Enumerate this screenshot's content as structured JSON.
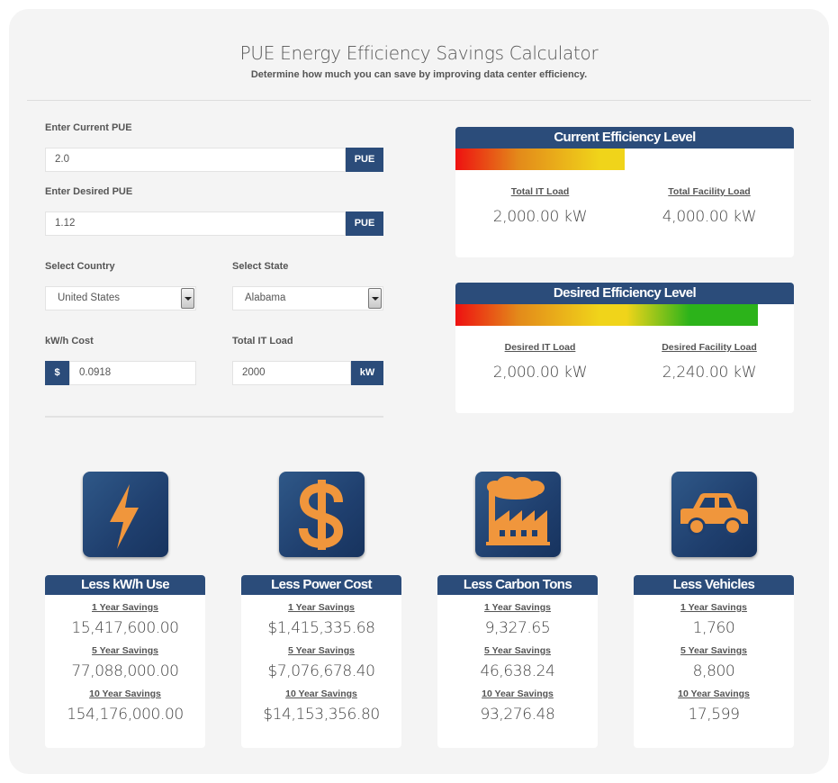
{
  "header": {
    "title": "PUE Energy Efficiency Savings Calculator",
    "subtitle": "Determine how much you can save by improving data center efficiency."
  },
  "form": {
    "current_pue": {
      "label": "Enter Current PUE",
      "value": "2.0",
      "addon": "PUE"
    },
    "desired_pue": {
      "label": "Enter Desired PUE",
      "value": "1.12",
      "addon": "PUE"
    },
    "country": {
      "label": "Select Country",
      "selected": "United States"
    },
    "state": {
      "label": "Select State",
      "selected": "Alabama"
    },
    "kwh_cost": {
      "label": "kW/h Cost",
      "prefix": "$",
      "value": "0.0918"
    },
    "it_load": {
      "label": "Total IT Load",
      "value": "2000",
      "addon": "kW"
    }
  },
  "current_efficiency": {
    "title": "Current Efficiency Level",
    "level_fraction": 0.5,
    "left_label": "Total IT Load",
    "left_value": "2,000.00 kW",
    "right_label": "Total Facility Load",
    "right_value": "4,000.00 kW"
  },
  "desired_efficiency": {
    "title": "Desired Efficiency Level",
    "level_fraction": 0.893,
    "left_label": "Desired IT Load",
    "left_value": "2,000.00 kW",
    "right_label": "Desired Facility Load",
    "right_value": "2,240.00 kW"
  },
  "colors": {
    "navy": "#2b4c7a",
    "icon_orange": "#f0963c",
    "gradient": [
      "#ee1111",
      "#e38a1a",
      "#f0d41a",
      "#2cb31a"
    ]
  },
  "savings": [
    {
      "icon": "lightning-bolt-icon",
      "title": "Less kW/h Use",
      "rows": [
        {
          "label": "1 Year Savings",
          "value": "15,417,600.00"
        },
        {
          "label": "5 Year Savings",
          "value": "77,088,000.00"
        },
        {
          "label": "10 Year Savings",
          "value": "154,176,000.00"
        }
      ]
    },
    {
      "icon": "dollar-sign-icon",
      "title": "Less Power Cost",
      "rows": [
        {
          "label": "1 Year Savings",
          "value": "$1,415,335.68"
        },
        {
          "label": "5 Year Savings",
          "value": "$7,076,678.40"
        },
        {
          "label": "10 Year Savings",
          "value": "$14,153,356.80"
        }
      ]
    },
    {
      "icon": "factory-icon",
      "title": "Less Carbon Tons",
      "rows": [
        {
          "label": "1 Year Savings",
          "value": "9,327.65"
        },
        {
          "label": "5 Year Savings",
          "value": "46,638.24"
        },
        {
          "label": "10 Year Savings",
          "value": "93,276.48"
        }
      ]
    },
    {
      "icon": "car-icon",
      "title": "Less Vehicles",
      "rows": [
        {
          "label": "1 Year Savings",
          "value": "1,760"
        },
        {
          "label": "5 Year Savings",
          "value": "8,800"
        },
        {
          "label": "10 Year Savings",
          "value": "17,599"
        }
      ]
    }
  ]
}
